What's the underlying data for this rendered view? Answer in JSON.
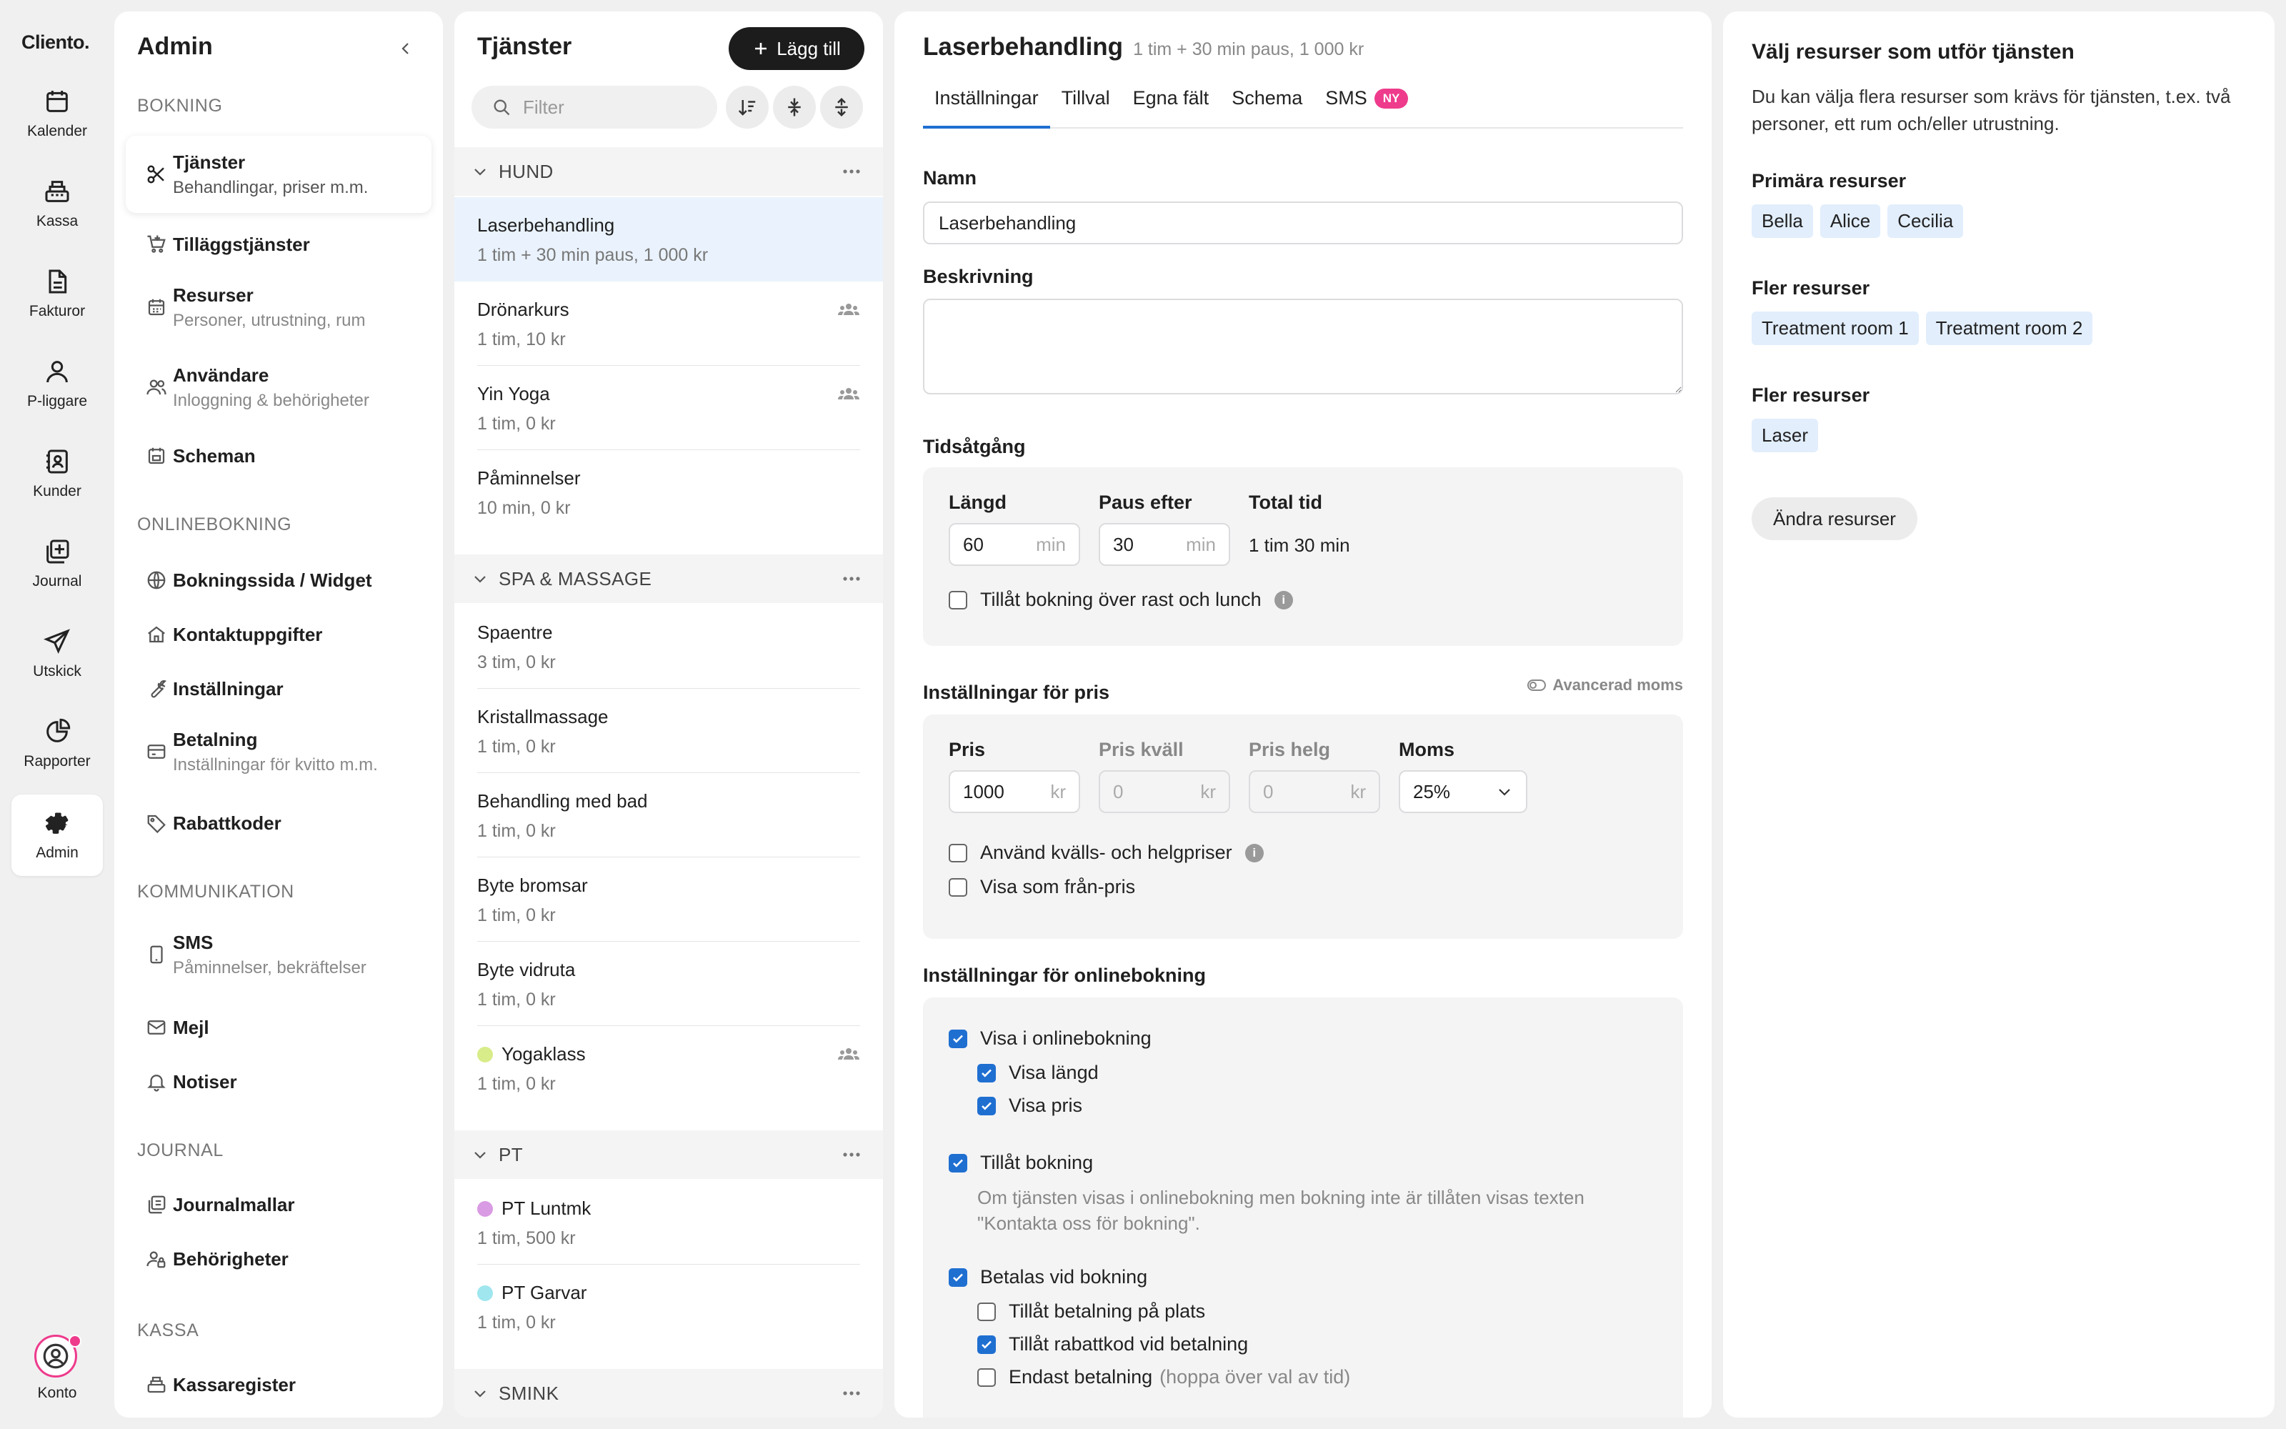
{
  "app": {
    "logo": "Cliento."
  },
  "rail": {
    "items": [
      {
        "label": "Kalender",
        "icon": "calendar-icon"
      },
      {
        "label": "Kassa",
        "icon": "cash-register-icon"
      },
      {
        "label": "Fakturor",
        "icon": "invoice-icon"
      },
      {
        "label": "P-liggare",
        "icon": "person-icon"
      },
      {
        "label": "Kunder",
        "icon": "contacts-icon"
      },
      {
        "label": "Journal",
        "icon": "journal-icon"
      },
      {
        "label": "Utskick",
        "icon": "send-icon"
      },
      {
        "label": "Rapporter",
        "icon": "pie-chart-icon"
      },
      {
        "label": "Admin",
        "icon": "gear-icon"
      }
    ],
    "account": "Konto"
  },
  "admin": {
    "title": "Admin",
    "sections": {
      "bokning": "BOKNING",
      "onlinebokning": "ONLINEBOKNING",
      "kommunikation": "KOMMUNIKATION",
      "journal": "JOURNAL",
      "kassa": "KASSA"
    },
    "nav": {
      "tjanster": {
        "title": "Tjänster",
        "sub": "Behandlingar, priser m.m."
      },
      "tillagg": {
        "title": "Tilläggstjänster"
      },
      "resurser": {
        "title": "Resurser",
        "sub": "Personer, utrustning, rum"
      },
      "anvandare": {
        "title": "Användare",
        "sub": "Inloggning & behörigheter"
      },
      "scheman": {
        "title": "Scheman"
      },
      "bokningssida": {
        "title": "Bokningssida / Widget"
      },
      "kontakt": {
        "title": "Kontaktuppgifter"
      },
      "installningar": {
        "title": "Inställningar"
      },
      "betalning": {
        "title": "Betalning",
        "sub": "Inställningar för kvitto m.m."
      },
      "rabatt": {
        "title": "Rabattkoder"
      },
      "sms": {
        "title": "SMS",
        "sub": "Påminnelser, bekräftelser"
      },
      "mejl": {
        "title": "Mejl"
      },
      "notiser": {
        "title": "Notiser"
      },
      "journalmallar": {
        "title": "Journalmallar"
      },
      "behorigheter": {
        "title": "Behörigheter"
      },
      "kassaregister": {
        "title": "Kassaregister"
      }
    }
  },
  "services": {
    "title": "Tjänster",
    "add_label": "Lägg till",
    "filter_placeholder": "Filter",
    "categories": {
      "hund": "HUND",
      "spa": "SPA & MASSAGE",
      "pt": "PT",
      "smink": "SMINK"
    },
    "items": {
      "laser": {
        "name": "Laserbehandling",
        "desc": "1 tim + 30 min paus, 1 000 kr"
      },
      "dronar": {
        "name": "Drönarkurs",
        "desc": "1 tim, 10 kr"
      },
      "yin": {
        "name": "Yin Yoga",
        "desc": "1 tim, 0 kr"
      },
      "pamin": {
        "name": "Påminnelser",
        "desc": "10 min, 0 kr"
      },
      "spaentre": {
        "name": "Spaentre",
        "desc": "3 tim, 0 kr"
      },
      "kristall": {
        "name": "Kristallmassage",
        "desc": "1 tim, 0 kr"
      },
      "bad": {
        "name": "Behandling med bad",
        "desc": "1 tim, 0 kr"
      },
      "bromsar": {
        "name": "Byte bromsar",
        "desc": "1 tim, 0 kr"
      },
      "vidruta": {
        "name": "Byte vidruta",
        "desc": "1 tim, 0 kr"
      },
      "yogaklass": {
        "name": "Yogaklass",
        "desc": "1 tim, 0 kr",
        "color": "#d8ec8a"
      },
      "luntmk": {
        "name": "PT Luntmk",
        "desc": "1 tim, 500 kr",
        "color": "#d99be3"
      },
      "garvar": {
        "name": "PT Garvar",
        "desc": "1 tim, 0 kr",
        "color": "#9fe6ee"
      }
    }
  },
  "detail": {
    "title": "Laserbehandling",
    "subtitle": "1 tim + 30 min paus, 1 000 kr",
    "tabs": {
      "installningar": "Inställningar",
      "tillval": "Tillval",
      "egna": "Egna fält",
      "schema": "Schema",
      "sms": "SMS",
      "ny_badge": "NY"
    },
    "name_label": "Namn",
    "name_value": "Laserbehandling",
    "desc_label": "Beskrivning",
    "desc_value": "",
    "time": {
      "heading": "Tidsåtgång",
      "length_label": "Längd",
      "length_value": "60",
      "length_unit": "min",
      "pause_label": "Paus efter",
      "pause_value": "30",
      "pause_unit": "min",
      "total_label": "Total tid",
      "total_value": "1 tim 30 min",
      "allow_break": "Tillåt bokning över rast och lunch"
    },
    "price": {
      "heading": "Inställningar för pris",
      "advanced": "Avancerad moms",
      "price_label": "Pris",
      "price_value": "1000",
      "unit": "kr",
      "evening_label": "Pris kväll",
      "evening_value": "0",
      "weekend_label": "Pris helg",
      "weekend_value": "0",
      "vat_label": "Moms",
      "vat_value": "25%",
      "use_evening": "Använd kvälls- och helgpriser",
      "from_price": "Visa som från-pris"
    },
    "online": {
      "heading": "Inställningar för onlinebokning",
      "show_online": "Visa i onlinebokning",
      "show_length": "Visa längd",
      "show_price": "Visa pris",
      "allow_booking": "Tillåt bokning",
      "allow_hint": "Om tjänsten visas i onlinebokning men bokning inte är tillåten visas texten \"Kontakta oss för bokning\".",
      "pay_on_booking": "Betalas vid bokning",
      "pay_on_site": "Tillåt betalning på plats",
      "discount_code": "Tillåt rabattkod vid betalning",
      "only_payment": "Endast betalning",
      "only_payment_hint": "(hoppa över val av tid)"
    }
  },
  "resources": {
    "heading": "Välj resurser som utför tjänsten",
    "description": "Du kan välja flera resurser som krävs för tjänsten, t.ex. två personer, ett rum och/eller utrustning.",
    "primary_label": "Primära resurser",
    "primary": [
      "Bella",
      "Alice",
      "Cecilia"
    ],
    "more1_label": "Fler resurser",
    "more1": [
      "Treatment room 1",
      "Treatment room 2"
    ],
    "more2_label": "Fler resurser",
    "more2": [
      "Laser"
    ],
    "change_button": "Ändra resurser"
  }
}
